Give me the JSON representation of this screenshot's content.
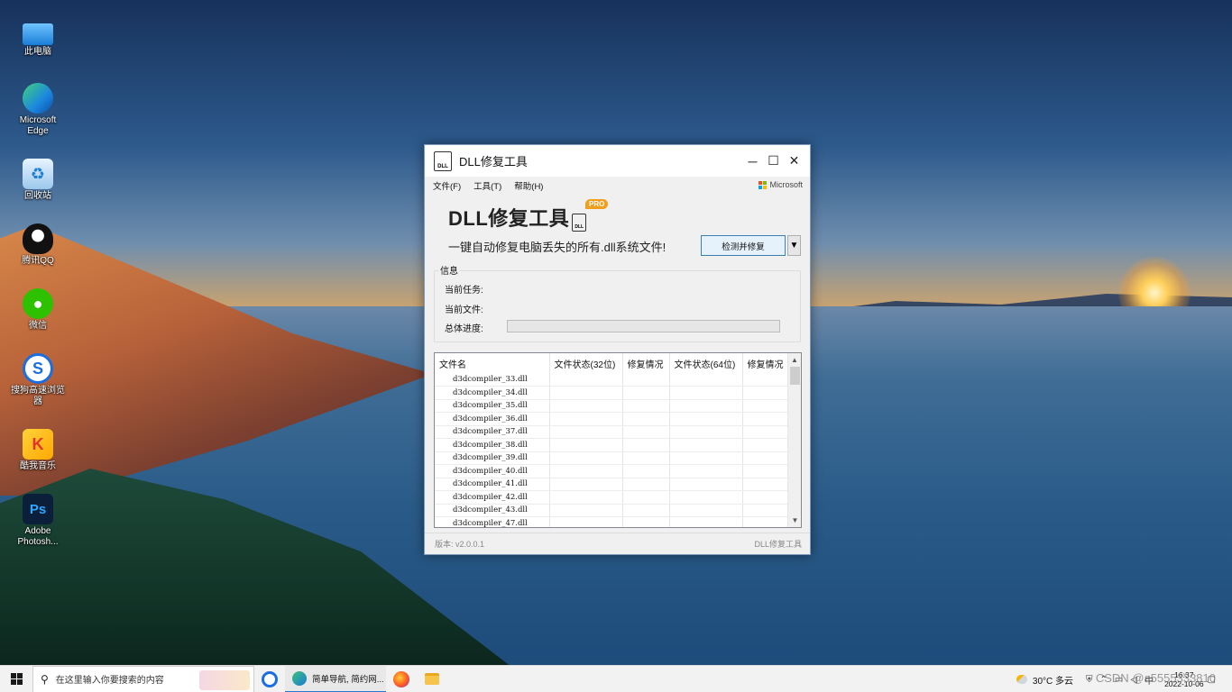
{
  "desktop": {
    "icons": [
      {
        "label": "此电脑",
        "icon": "computer-icon"
      },
      {
        "label": "Microsoft Edge",
        "icon": "edge-icon"
      },
      {
        "label": "回收站",
        "icon": "recycle-bin-icon"
      },
      {
        "label": "腾讯QQ",
        "icon": "qq-icon"
      },
      {
        "label": "微信",
        "icon": "wechat-icon"
      },
      {
        "label": "搜狗高速浏览器",
        "icon": "sogou-browser-icon"
      },
      {
        "label": "酷我音乐",
        "icon": "kuwo-music-icon"
      },
      {
        "label": "Adobe Photosh...",
        "icon": "photoshop-icon"
      }
    ]
  },
  "window": {
    "title": "DLL修复工具",
    "controls": {
      "minimize": "─",
      "maximize": "☐",
      "close": "✕"
    },
    "menu": [
      {
        "label": "文件(F)"
      },
      {
        "label": "工具(T)"
      },
      {
        "label": "帮助(H)"
      }
    ],
    "brand_badge": "Microsoft",
    "brand_title": "DLL修复工具",
    "pro_badge": "PRO",
    "slogan": "一键自动修复电脑丢失的所有.dll系统文件!",
    "detect_button": "检测并修复",
    "dropdown_glyph": "▼",
    "info_group": "信息",
    "current_task_label": "当前任务:",
    "current_file_label": "当前文件:",
    "total_progress_label": "总体进度:",
    "total_progress": 0,
    "table": {
      "columns": [
        "文件名",
        "文件状态(32位)",
        "修复情况",
        "文件状态(64位)",
        "修复情况"
      ],
      "rows": [
        "d3dcompiler_33.dll",
        "d3dcompiler_34.dll",
        "d3dcompiler_35.dll",
        "d3dcompiler_36.dll",
        "d3dcompiler_37.dll",
        "d3dcompiler_38.dll",
        "d3dcompiler_39.dll",
        "d3dcompiler_40.dll",
        "d3dcompiler_41.dll",
        "d3dcompiler_42.dll",
        "d3dcompiler_43.dll",
        "d3dcompiler_47.dll"
      ]
    },
    "version": "版本: v2.0.0.1",
    "status_right": "DLL修复工具"
  },
  "taskbar": {
    "search_placeholder": "在这里输入你要搜索的内容",
    "edge_task_label": "简单导航, 简约网...",
    "weather": "30°C 多云",
    "clock_time": "16:37",
    "clock_date": "2022-10-06",
    "watermark": "CSDN @a5555333810"
  }
}
